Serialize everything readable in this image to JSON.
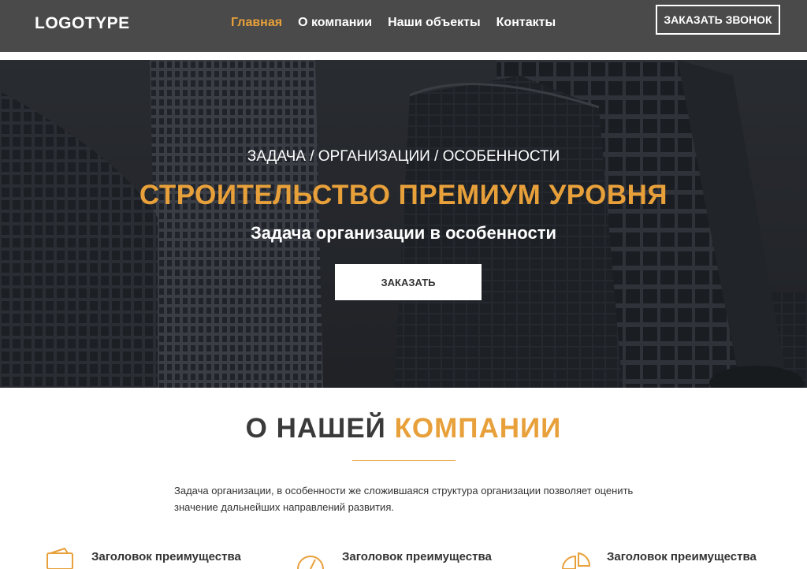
{
  "header": {
    "logo": "LOGOTYPE",
    "nav": [
      {
        "label": "Главная",
        "active": true
      },
      {
        "label": "О компании",
        "active": false
      },
      {
        "label": "Наши объекты",
        "active": false
      },
      {
        "label": "Контакты",
        "active": false
      }
    ],
    "call_button": "ЗАКАЗАТЬ ЗВОНОК"
  },
  "hero": {
    "subtitle": "ЗАДАЧА / ОРГАНИЗАЦИИ / ОСОБЕННОСТИ",
    "title": "СТРОИТЕЛЬСТВО ПРЕМИУМ УРОВНЯ",
    "tagline": "Задача организации в особенности",
    "order_button": "ЗАКАЗАТЬ"
  },
  "about": {
    "heading_dark": "О НАШЕЙ",
    "heading_accent": "КОМПАНИИ",
    "text": "Задача организации, в особенности же сложившаяся структура организации позволяет оценить значение дальнейших направлений развития."
  },
  "features": [
    {
      "icon": "wallet-icon",
      "title": "Заголовок преимущества"
    },
    {
      "icon": "speedometer-icon",
      "title": "Заголовок преимущества"
    },
    {
      "icon": "pie-chart-icon",
      "title": "Заголовок преимущества"
    }
  ],
  "colors": {
    "accent": "#e8a03a",
    "header_bg": "#4a4a4a",
    "dark_text": "#3a3a3a"
  }
}
